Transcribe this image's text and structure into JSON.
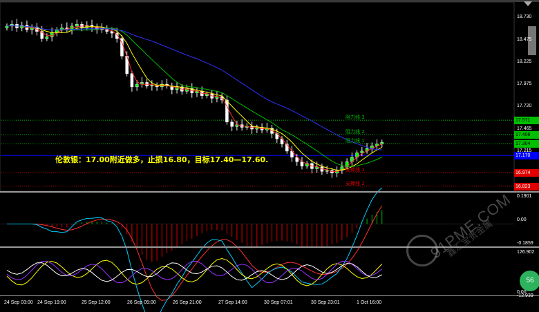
{
  "chart_data": [
    {
      "type": "candlestick",
      "title": "",
      "instrument_note": "伦敦银：17.00附近做多，止损16.80，目标17.40—17.60.",
      "ylim": [
        16.823,
        18.73
      ],
      "y_ticks": [
        "18.730",
        "18.475",
        "18.225",
        "17.975",
        "17.720",
        "17.465",
        "17.215"
      ],
      "x_ticks": [
        "24 Sep 03:00",
        "24 Sep 19:00",
        "25 Sep 12:00",
        "26 Sep 05:00",
        "26 Sep 21:00",
        "27 Sep 14:00",
        "30 Sep 07:01",
        "30 Sep 23:01",
        "1 Oct 16:00"
      ],
      "levels": [
        {
          "label": "阻力线 3",
          "value": 17.571,
          "color": "#00c000",
          "style": "dotted"
        },
        {
          "label": "阻力线 2",
          "value": 17.406,
          "color": "#00c000",
          "style": "dotted"
        },
        {
          "label": "阻力线 1",
          "value": 17.304,
          "color": "#00c000",
          "style": "dotted"
        },
        {
          "label": "支撑线 1",
          "value": 16.974,
          "color": "#e00000",
          "style": "dotted"
        },
        {
          "label": "支撑线 2",
          "value": 16.823,
          "color": "#e00000",
          "style": "dotted"
        }
      ],
      "current_line": {
        "value": 17.17,
        "label": "17.170"
      },
      "price_boxes": [
        {
          "label": "17.571",
          "value": 17.571,
          "bg": "#00c000",
          "fg": "#000000"
        },
        {
          "label": "17.406",
          "value": 17.406,
          "bg": "#00c000",
          "fg": "#000000"
        },
        {
          "label": "17.304",
          "value": 17.304,
          "bg": "#00c000",
          "fg": "#000000"
        },
        {
          "label": "17.170",
          "value": 17.17,
          "bg": "#0000ff",
          "fg": "#ffffff"
        },
        {
          "label": "16.974",
          "value": 16.974,
          "bg": "#e00000",
          "fg": "#ffffff"
        },
        {
          "label": "16.823",
          "value": 16.823,
          "bg": "#e00000",
          "fg": "#ffffff"
        }
      ],
      "close_series": [
        18.64,
        18.66,
        18.62,
        18.65,
        18.6,
        18.63,
        18.58,
        18.5,
        18.52,
        18.57,
        18.6,
        18.62,
        18.6,
        18.64,
        18.66,
        18.62,
        18.65,
        18.63,
        18.6,
        18.62,
        18.58,
        18.56,
        18.5,
        18.3,
        18.1,
        17.95,
        17.98,
        18.0,
        17.96,
        17.97,
        17.95,
        17.98,
        17.96,
        17.92,
        17.95,
        17.9,
        17.93,
        17.88,
        17.9,
        17.85,
        17.87,
        17.82,
        17.84,
        17.8,
        17.55,
        17.5,
        17.52,
        17.49,
        17.5,
        17.47,
        17.49,
        17.46,
        17.48,
        17.42,
        17.36,
        17.3,
        17.22,
        17.15,
        17.1,
        17.05,
        17.08,
        17.02,
        17.04,
        16.99,
        17.0,
        16.97,
        17.0,
        17.04,
        17.1,
        17.15,
        17.2,
        17.22,
        17.25,
        17.28,
        17.3,
        17.32
      ],
      "candle_colors": {
        "up": "#00ff00",
        "down": "#ffffff",
        "wick": "#ffffff"
      },
      "ma_colors": [
        "#ff3030",
        "#ffff00",
        "#00c000",
        "#3030ff"
      ]
    },
    {
      "type": "bar",
      "title": "",
      "y_ticks": [
        "0.1901",
        "0.00",
        "-0.1859"
      ],
      "ylim": [
        -0.1859,
        0.1901
      ],
      "colors": {
        "positive": "#00c000",
        "negative": "#e00000",
        "signal": "#ff3030",
        "macd": "#00ccff"
      }
    },
    {
      "type": "line",
      "title": "",
      "y_ticks": [
        "126.902",
        "0.00",
        "-12.939"
      ],
      "ylim": [
        -12.939,
        126.902
      ],
      "colors": [
        "#ffff00",
        "#9933ff",
        "#ffffff"
      ]
    }
  ],
  "watermark": {
    "line1": "91PME.COM",
    "line2": "鑫汇宝贵金属"
  },
  "badge": "56"
}
